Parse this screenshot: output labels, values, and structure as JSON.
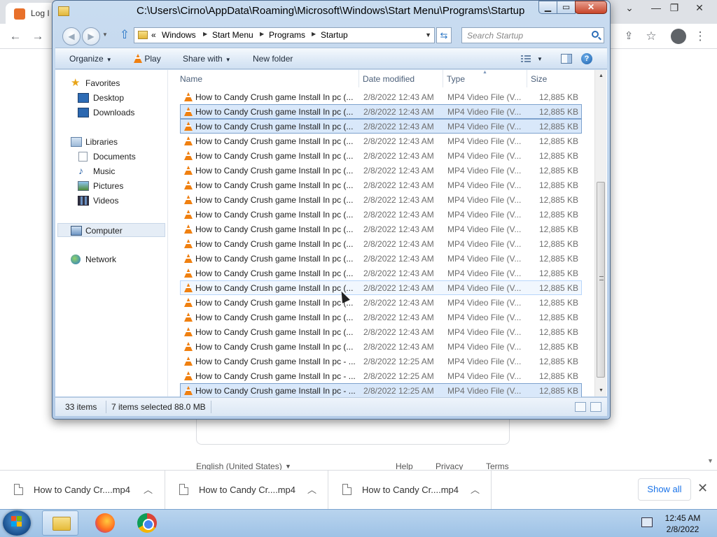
{
  "browser": {
    "tab_title": "Log I",
    "footer": {
      "language": "English (United States)",
      "help": "Help",
      "privacy": "Privacy",
      "terms": "Terms"
    }
  },
  "explorer": {
    "title": "C:\\Users\\Cirno\\AppData\\Roaming\\Microsoft\\Windows\\Start Menu\\Programs\\Startup",
    "address": {
      "overflow": "«",
      "crumbs": [
        "Windows",
        "Start Menu",
        "Programs",
        "Startup"
      ]
    },
    "search_placeholder": "Search Startup",
    "commands": {
      "organize": "Organize",
      "play": "Play",
      "share_with": "Share with",
      "new_folder": "New folder"
    },
    "nav": {
      "favorites": "Favorites",
      "desktop": "Desktop",
      "downloads": "Downloads",
      "libraries": "Libraries",
      "documents": "Documents",
      "music": "Music",
      "pictures": "Pictures",
      "videos": "Videos",
      "computer": "Computer",
      "network": "Network"
    },
    "columns": {
      "name": "Name",
      "date": "Date modified",
      "type": "Type",
      "size": "Size"
    },
    "files": [
      {
        "name": "How to Candy Crush game Install In pc (...",
        "date": "2/8/2022 12:43 AM",
        "type": "MP4 Video File (V...",
        "size": "12,885 KB",
        "selected": false
      },
      {
        "name": "How to Candy Crush game Install In pc (...",
        "date": "2/8/2022 12:43 AM",
        "type": "MP4 Video File (V...",
        "size": "12,885 KB",
        "selected": true
      },
      {
        "name": "How to Candy Crush game Install In pc (...",
        "date": "2/8/2022 12:43 AM",
        "type": "MP4 Video File (V...",
        "size": "12,885 KB",
        "selected": true
      },
      {
        "name": "How to Candy Crush game Install In pc (...",
        "date": "2/8/2022 12:43 AM",
        "type": "MP4 Video File (V...",
        "size": "12,885 KB",
        "selected": false
      },
      {
        "name": "How to Candy Crush game Install In pc (...",
        "date": "2/8/2022 12:43 AM",
        "type": "MP4 Video File (V...",
        "size": "12,885 KB",
        "selected": false
      },
      {
        "name": "How to Candy Crush game Install In pc (...",
        "date": "2/8/2022 12:43 AM",
        "type": "MP4 Video File (V...",
        "size": "12,885 KB",
        "selected": false
      },
      {
        "name": "How to Candy Crush game Install In pc (...",
        "date": "2/8/2022 12:43 AM",
        "type": "MP4 Video File (V...",
        "size": "12,885 KB",
        "selected": false
      },
      {
        "name": "How to Candy Crush game Install In pc (...",
        "date": "2/8/2022 12:43 AM",
        "type": "MP4 Video File (V...",
        "size": "12,885 KB",
        "selected": false
      },
      {
        "name": "How to Candy Crush game Install In pc (...",
        "date": "2/8/2022 12:43 AM",
        "type": "MP4 Video File (V...",
        "size": "12,885 KB",
        "selected": false
      },
      {
        "name": "How to Candy Crush game Install In pc (...",
        "date": "2/8/2022 12:43 AM",
        "type": "MP4 Video File (V...",
        "size": "12,885 KB",
        "selected": false
      },
      {
        "name": "How to Candy Crush game Install In pc (...",
        "date": "2/8/2022 12:43 AM",
        "type": "MP4 Video File (V...",
        "size": "12,885 KB",
        "selected": false
      },
      {
        "name": "How to Candy Crush game Install In pc (...",
        "date": "2/8/2022 12:43 AM",
        "type": "MP4 Video File (V...",
        "size": "12,885 KB",
        "selected": false
      },
      {
        "name": "How to Candy Crush game Install In pc (...",
        "date": "2/8/2022 12:43 AM",
        "type": "MP4 Video File (V...",
        "size": "12,885 KB",
        "selected": false
      },
      {
        "name": "How to Candy Crush game Install In pc (...",
        "date": "2/8/2022 12:43 AM",
        "type": "MP4 Video File (V...",
        "size": "12,885 KB",
        "selected": false,
        "hover": true
      },
      {
        "name": "How to Candy Crush game Install In pc (...",
        "date": "2/8/2022 12:43 AM",
        "type": "MP4 Video File (V...",
        "size": "12,885 KB",
        "selected": false
      },
      {
        "name": "How to Candy Crush game Install In pc (...",
        "date": "2/8/2022 12:43 AM",
        "type": "MP4 Video File (V...",
        "size": "12,885 KB",
        "selected": false
      },
      {
        "name": "How to Candy Crush game Install In pc (...",
        "date": "2/8/2022 12:43 AM",
        "type": "MP4 Video File (V...",
        "size": "12,885 KB",
        "selected": false
      },
      {
        "name": "How to Candy Crush game Install In pc (...",
        "date": "2/8/2022 12:43 AM",
        "type": "MP4 Video File (V...",
        "size": "12,885 KB",
        "selected": false
      },
      {
        "name": "How to Candy Crush game Install In pc - ...",
        "date": "2/8/2022 12:25 AM",
        "type": "MP4 Video File (V...",
        "size": "12,885 KB",
        "selected": false
      },
      {
        "name": "How to Candy Crush game Install In pc - ...",
        "date": "2/8/2022 12:25 AM",
        "type": "MP4 Video File (V...",
        "size": "12,885 KB",
        "selected": false
      },
      {
        "name": "How to Candy Crush game Install In pc - ...",
        "date": "2/8/2022 12:25 AM",
        "type": "MP4 Video File (V...",
        "size": "12,885 KB",
        "selected": true
      }
    ],
    "status": {
      "count": "33 items",
      "selection": "7 items selected",
      "size": "88.0 MB"
    }
  },
  "downloads": {
    "items": [
      "How to Candy Cr....mp4",
      "How to Candy Cr....mp4",
      "How to Candy Cr....mp4"
    ],
    "show_all": "Show all"
  },
  "taskbar": {
    "time": "12:45 AM",
    "date": "2/8/2022"
  },
  "colors": {
    "selection": "#d9e8fa",
    "selection_border": "#7da2ce",
    "vlc_orange": "#f08010",
    "link_blue": "#1a73e8"
  },
  "icons": {
    "file": "vlc-cone-icon",
    "nav": [
      "star-icon",
      "desktop-icon",
      "downloads-icon",
      "libraries-icon",
      "documents-icon",
      "music-icon",
      "pictures-icon",
      "videos-icon",
      "computer-icon",
      "network-icon"
    ]
  }
}
